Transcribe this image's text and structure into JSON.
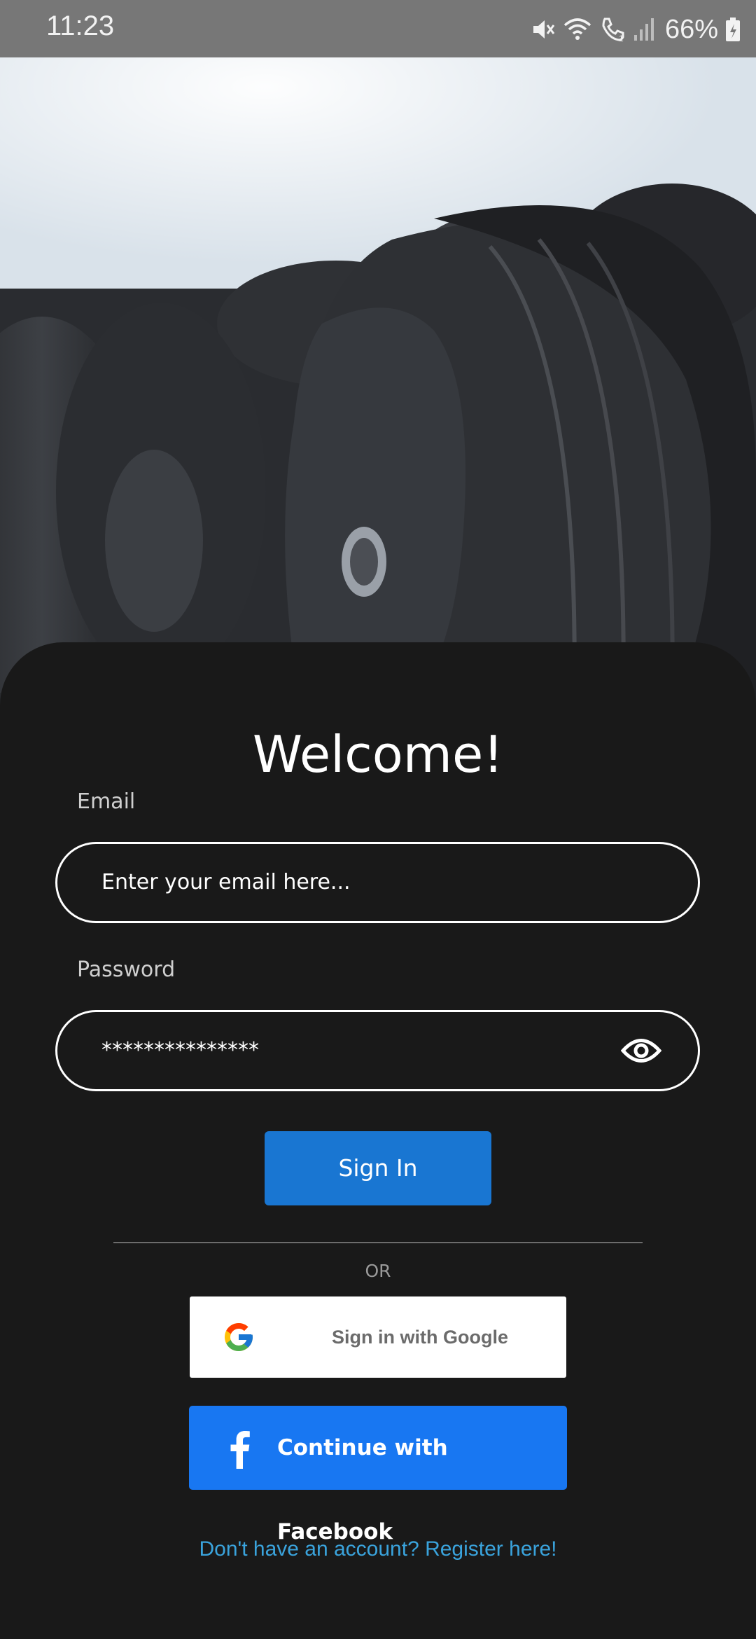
{
  "status_bar": {
    "time": "11:23",
    "battery_text": "66%",
    "icons": [
      "mute-icon",
      "wifi-icon",
      "call-icon",
      "signal-icon",
      "battery-icon"
    ]
  },
  "hero": {
    "image": "dumbbell-rack-photo"
  },
  "login": {
    "title": "Welcome!",
    "email_label": "Email",
    "email_placeholder": "Enter your email here...",
    "password_label": "Password",
    "password_value": "***************",
    "password_toggle_icon": "eye-icon",
    "sign_in_label": "Sign In",
    "or_text": "OR",
    "google_label": "Sign in with Google",
    "facebook_label": "Continue with Facebook",
    "register_text": "Don't have an account? Register here!"
  },
  "colors": {
    "background": "#191919",
    "primary_button": "#1976d2",
    "facebook": "#1877f2",
    "link": "#3aa3dc",
    "status_bar": "#777777"
  }
}
